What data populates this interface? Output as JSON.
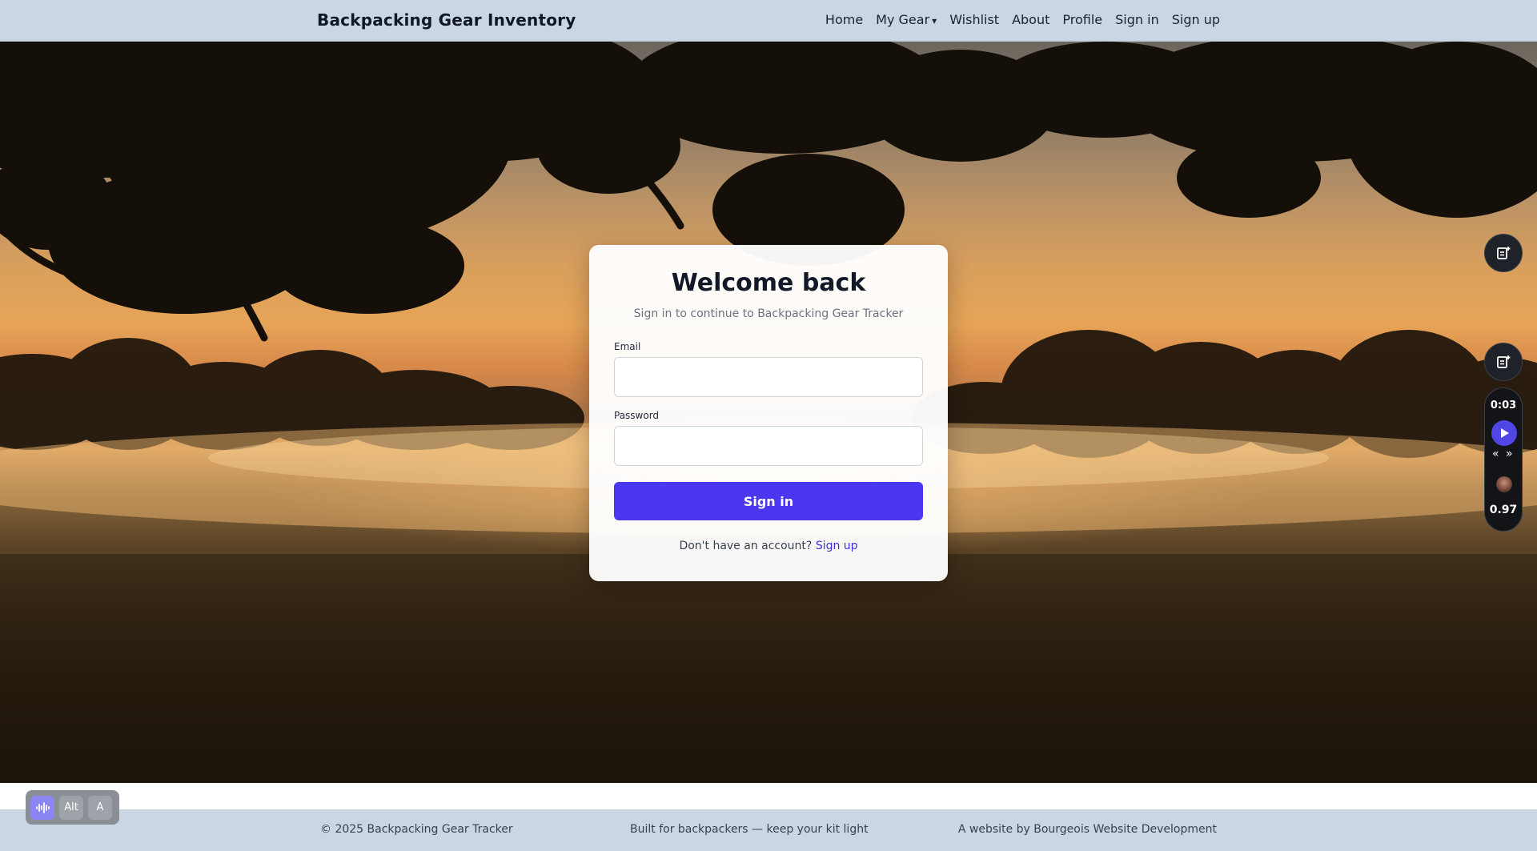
{
  "navbar": {
    "brand": "Backpacking Gear Inventory",
    "links": [
      {
        "label": "Home"
      },
      {
        "label": "My Gear",
        "caret": "▾"
      },
      {
        "label": "Wishlist"
      },
      {
        "label": "About"
      },
      {
        "label": "Profile"
      },
      {
        "label": "Sign in"
      },
      {
        "label": "Sign up"
      }
    ]
  },
  "login": {
    "title": "Welcome back",
    "subtitle": "Sign in to continue to Backpacking Gear Tracker",
    "email_label": "Email",
    "email_value": "",
    "password_label": "Password",
    "password_value": "",
    "submit_label": "Sign in",
    "footer_prompt": "Don't have an account?",
    "footer_link": "Sign up"
  },
  "player": {
    "time": "0:03",
    "skip_back": "«",
    "skip_forward": "»",
    "speed": "0.97"
  },
  "toolbar": {
    "buttons": [
      {
        "label": "",
        "icon": "waveform-icon"
      },
      {
        "label": "Alt"
      },
      {
        "label": "A"
      }
    ]
  },
  "footer": {
    "copyright": "© 2025 Backpacking Gear Tracker",
    "tagline": "Built for backpackers — keep your kit light",
    "credit": "A website by Bourgeois Website Development"
  },
  "theme": {
    "nav_bg": "#cad6e3",
    "primary": "#4a37ef",
    "link": "#3b2fd8"
  }
}
